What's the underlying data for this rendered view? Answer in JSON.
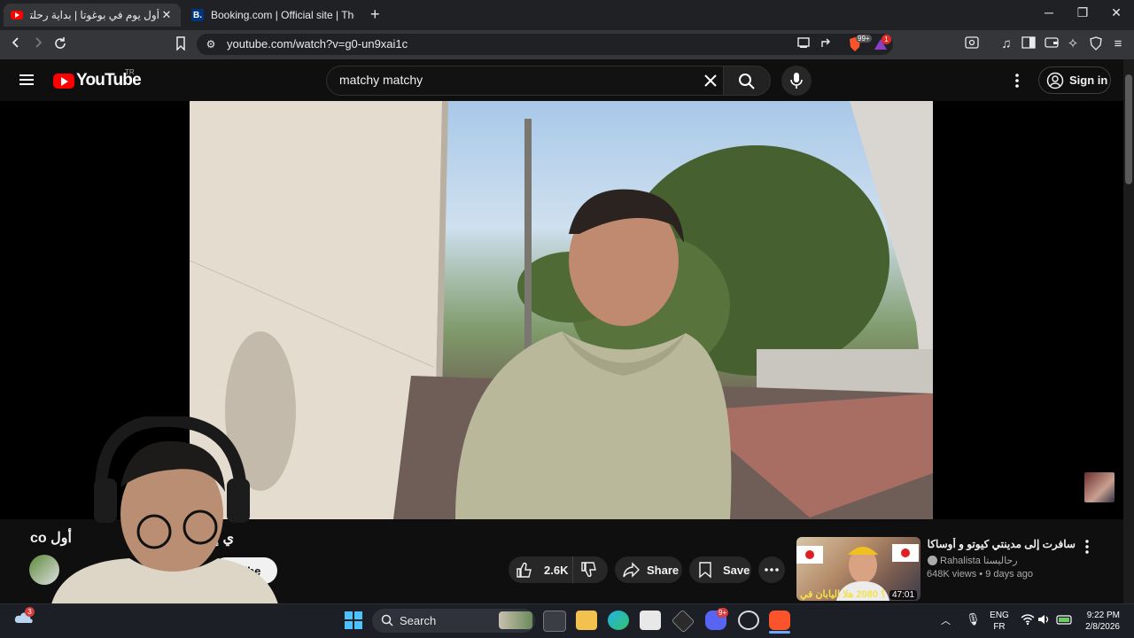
{
  "browser": {
    "tabs": [
      {
        "title": "أول يوم في بوغوتا | بداية رحلتي إل",
        "favicon": "youtube-favicon",
        "active": true
      },
      {
        "title": "Booking.com | Official site | The best",
        "favicon": "booking-favicon",
        "favicon_letter": "B.",
        "active": false
      }
    ],
    "new_tab": "+",
    "url": "youtube.com/watch?v=g0-un9xai1c",
    "brave_badge": "99+",
    "alert_badge": "1"
  },
  "youtube": {
    "logo_text": "YouTube",
    "country_code": "TR",
    "search_value": "matchy matchy",
    "sign_in_label": "Sign in",
    "video": {
      "title_arabic": "أول",
      "title_latin": "co",
      "title_arabic_end": "ي إلى كولومبيا",
      "subscribe_label": "scribe",
      "likes": "2.6K",
      "share_label": "Share",
      "save_label": "Save"
    },
    "recommended": {
      "title": "سافرت إلى مدينتي كيوتو و أوساكا في اليابان",
      "channel": "Rahalista رحاليستا",
      "meta": "648K views • 9 days ago",
      "duration": "47:01",
      "thumb_caption": "؟ 2080 هلا اليابان في"
    }
  },
  "taskbar": {
    "search_label": "Search",
    "weather_badge": "3",
    "discord_badge": "9+",
    "lang_primary": "ENG",
    "lang_secondary": "FR",
    "time": "9:22 PM",
    "date": "2/8/2026"
  },
  "colors": {
    "youtube_red": "#ff0000",
    "page_bg": "#0f0f0f",
    "browser_chrome": "#35363a"
  }
}
